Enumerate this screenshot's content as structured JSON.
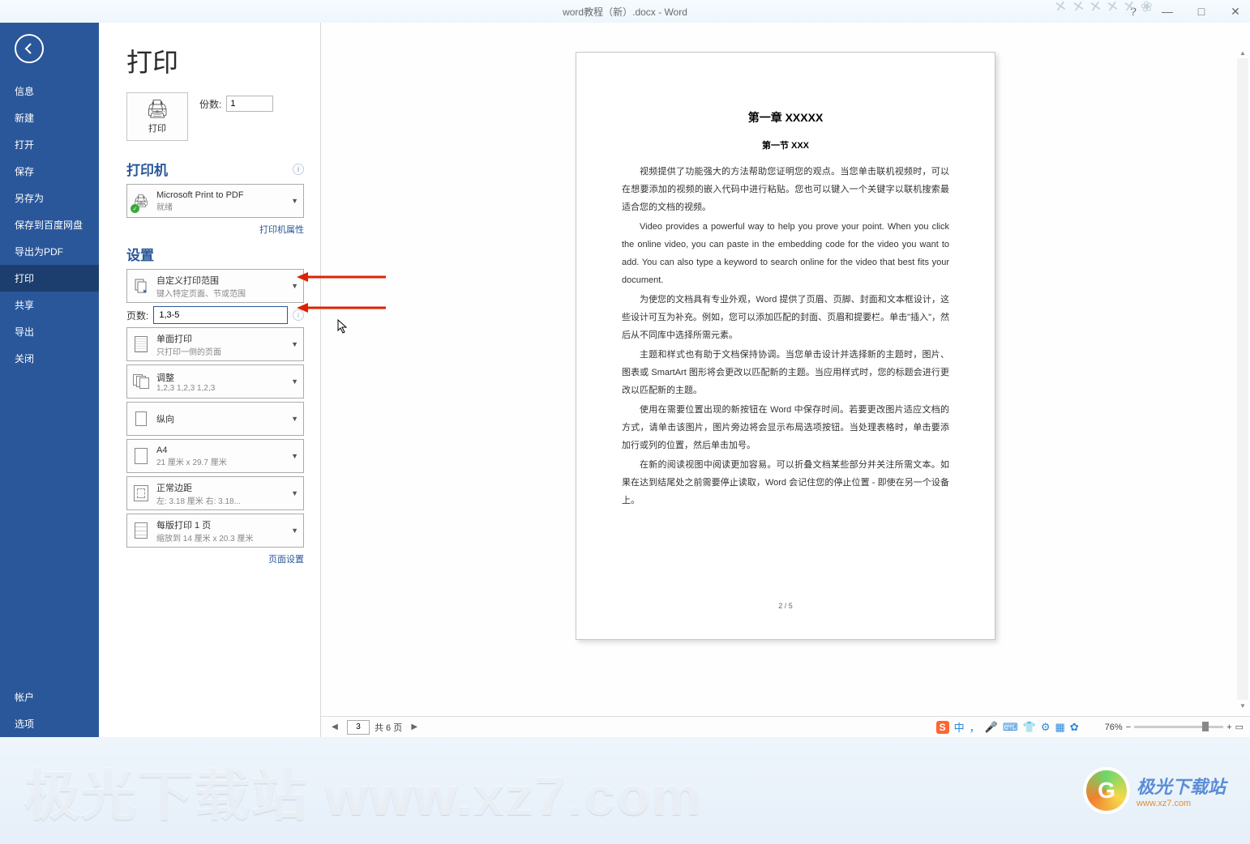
{
  "titlebar": {
    "document_title": "word教程（新）.docx - Word",
    "help": "?",
    "minimize": "—",
    "maximize": "□",
    "close": "✕"
  },
  "sidebar": {
    "items": [
      {
        "label": "信息"
      },
      {
        "label": "新建"
      },
      {
        "label": "打开"
      },
      {
        "label": "保存"
      },
      {
        "label": "另存为"
      },
      {
        "label": "保存到百度网盘"
      },
      {
        "label": "导出为PDF"
      },
      {
        "label": "打印",
        "active": true
      },
      {
        "label": "共享"
      },
      {
        "label": "导出"
      },
      {
        "label": "关闭"
      }
    ],
    "bottom_items": [
      {
        "label": "帐户"
      },
      {
        "label": "选项"
      }
    ]
  },
  "panel": {
    "title": "打印",
    "print_button_label": "打印",
    "copies_label": "份数:",
    "copies_value": "1",
    "printer_section": "打印机",
    "printer": {
      "name": "Microsoft Print to PDF",
      "status": "就绪"
    },
    "printer_properties": "打印机属性",
    "settings_section": "设置",
    "range": {
      "title": "自定义打印范围",
      "sub": "键入特定页面、节或范围"
    },
    "pages_label": "页数:",
    "pages_value": "1,3-5",
    "duplex": {
      "title": "单面打印",
      "sub": "只打印一侧的页面"
    },
    "collate": {
      "title": "调整",
      "sub": "1,2,3    1,2,3    1,2,3"
    },
    "orientation": {
      "title": "纵向",
      "sub": ""
    },
    "paper": {
      "title": "A4",
      "sub": "21 厘米 x 29.7 厘米"
    },
    "margins": {
      "title": "正常边距",
      "sub": "左: 3.18 厘米   右: 3.18..."
    },
    "perpage": {
      "title": "每版打印 1 页",
      "sub": "缩放到 14 厘米 x 20.3 厘米"
    },
    "page_setup": "页面设置"
  },
  "preview": {
    "heading": "第一章 XXXXX",
    "subheading": "第一节 XXX",
    "para1": "视频提供了功能强大的方法帮助您证明您的观点。当您单击联机视频时，可以在想要添加的视频的嵌入代码中进行粘贴。您也可以键入一个关键字以联机搜索最适合您的文档的视频。",
    "para2": "Video provides a powerful way to help you prove your point. When you click the online video, you can paste in the embedding code for the video you want to add. You can also type a keyword to search online for the video that best fits your document.",
    "para3": "为使您的文档具有专业外观，Word 提供了页眉、页脚、封面和文本框设计，这些设计可互为补充。例如，您可以添加匹配的封面、页眉和提要栏。单击\"插入\"，然后从不同库中选择所需元素。",
    "para4": "主题和样式也有助于文档保持协调。当您单击设计并选择新的主题时，图片、图表或 SmartArt 图形将会更改以匹配新的主题。当应用样式时，您的标题会进行更改以匹配新的主题。",
    "para5": "使用在需要位置出现的新按钮在 Word 中保存时间。若要更改图片适应文档的方式，请单击该图片，图片旁边将会显示布局选项按钮。当处理表格时，单击要添加行或列的位置，然后单击加号。",
    "para6": "在新的阅读视图中阅读更加容易。可以折叠文档某些部分并关注所需文本。如果在达到结尾处之前需要停止读取，Word 会记住您的停止位置 - 即使在另一个设备上。",
    "page_number": "2 / 5"
  },
  "statusbar": {
    "current_page": "3",
    "total_pages_text": "共 6 页",
    "ime_label": "中",
    "zoom": "76%"
  },
  "watermark": {
    "text": "极光下载站 www.xz7.com",
    "logo_text": "极光下载站",
    "logo_url": "www.xz7.com"
  }
}
